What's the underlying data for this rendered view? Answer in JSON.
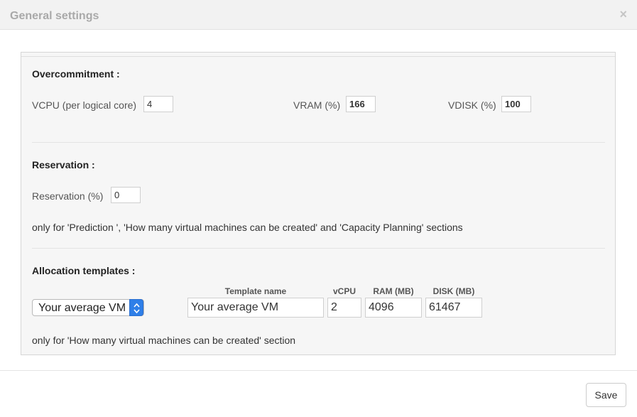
{
  "header": {
    "title": "General settings",
    "close_symbol": "×"
  },
  "overcommitment": {
    "title": "Overcommitment :",
    "vcpu_label": "VCPU (per logical core)",
    "vcpu_value": "4",
    "vram_label": "VRAM (%)",
    "vram_value": "166",
    "vdisk_label": "VDISK (%)",
    "vdisk_value": "100"
  },
  "reservation": {
    "title": "Reservation :",
    "label": "Reservation (%)",
    "value": "0",
    "note": "only for 'Prediction ', 'How many virtual machines can be created' and 'Capacity Planning' sections"
  },
  "allocation": {
    "title": "Allocation templates :",
    "select_value": "Your average VM",
    "columns": {
      "template_name": "Template name",
      "vcpu": "vCPU",
      "ram": "RAM (MB)",
      "disk": "DISK (MB)"
    },
    "values": {
      "template_name": "Your average VM",
      "vcpu": "2",
      "ram": "4096",
      "disk": "61467"
    },
    "note": "only for 'How many virtual machines can be created' section"
  },
  "footer": {
    "save_label": "Save"
  },
  "colors": {
    "select_accent": "#2f7fe8",
    "header_bg": "#f2f2f2",
    "panel_bg": "#f6f6f6"
  }
}
